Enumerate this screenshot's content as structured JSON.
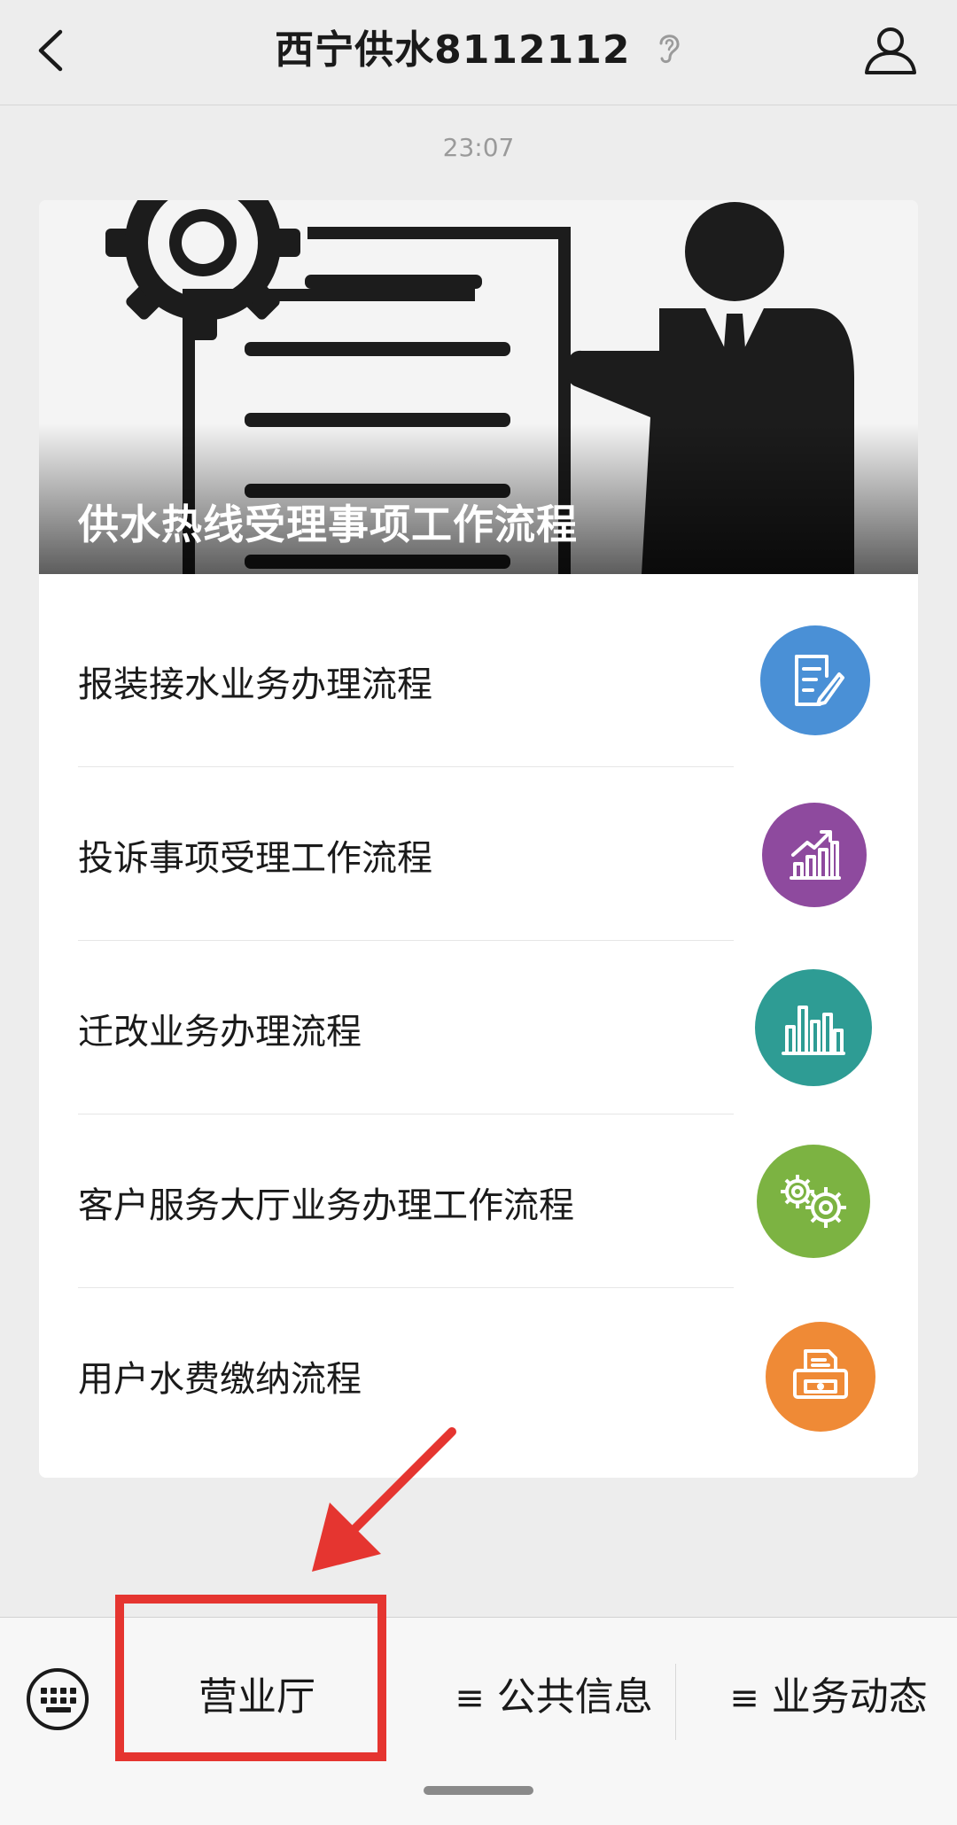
{
  "header": {
    "title": "西宁供水8112112",
    "back_icon": "chevron-left-icon",
    "ear_icon": "ear-icon",
    "profile_icon": "person-icon"
  },
  "message": {
    "time": "23:07",
    "hero_title": "供水热线受理事项工作流程",
    "items": [
      {
        "label": "报装接水业务办理流程",
        "icon": "document-pen-icon",
        "color": "#4a90d6"
      },
      {
        "label": "投诉事项受理工作流程",
        "icon": "growth-chart-icon",
        "color": "#8e4a9e"
      },
      {
        "label": "迁改业务办理流程",
        "icon": "bar-chart-icon",
        "color": "#2e9c94"
      },
      {
        "label": "客户服务大厅业务办理工作流程",
        "icon": "gears-icon",
        "color": "#7cb342"
      },
      {
        "label": "用户水费缴纳流程",
        "icon": "printer-icon",
        "color": "#ef8a36"
      }
    ]
  },
  "bottom_menu": {
    "keyboard_icon": "keyboard-icon",
    "items": [
      {
        "label": "营业厅"
      },
      {
        "label": "公共信息",
        "prefix": "≡"
      },
      {
        "label": "业务动态",
        "prefix": "≡"
      }
    ]
  },
  "annotation": {
    "color": "#e53530"
  }
}
